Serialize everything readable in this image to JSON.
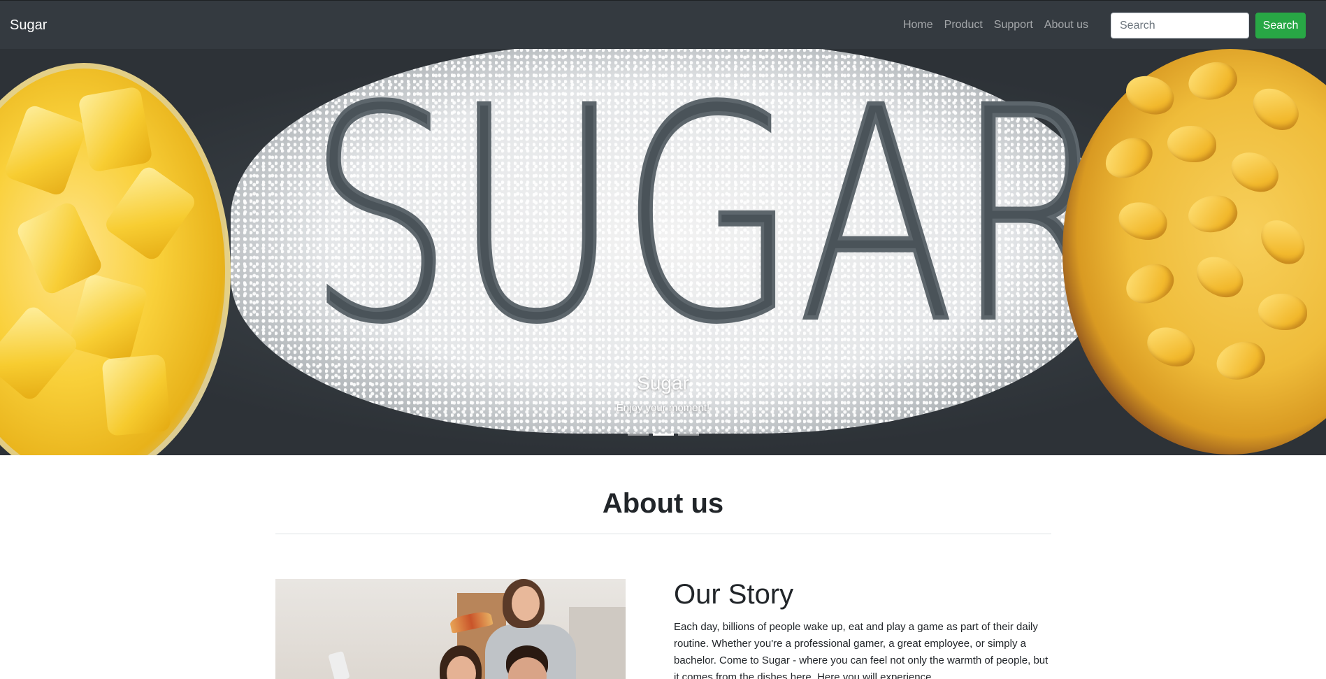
{
  "navbar": {
    "brand": "Sugar",
    "links": [
      "Home",
      "Product",
      "Support",
      "About us"
    ],
    "search_placeholder": "Search",
    "search_button": "Search"
  },
  "carousel": {
    "image_text": "SUGAR",
    "caption_title": "Sugar",
    "caption_subtitle": "Enjoy your moment!",
    "active_slide": 2,
    "slide_count": 3
  },
  "about": {
    "heading": "About us",
    "story_title": "Our Story",
    "story_text": "Each day, billions of people wake up, eat and play a game as part of their daily routine. Whether you're a professional gamer, a great employee, or simply a bachelor. Come to Sugar - where you can feel not only the warmth of people, but it comes from the dishes here. Here you will experience"
  },
  "colors": {
    "navbar_bg": "#343a40",
    "search_button_bg": "#28a745",
    "text": "#212529"
  }
}
